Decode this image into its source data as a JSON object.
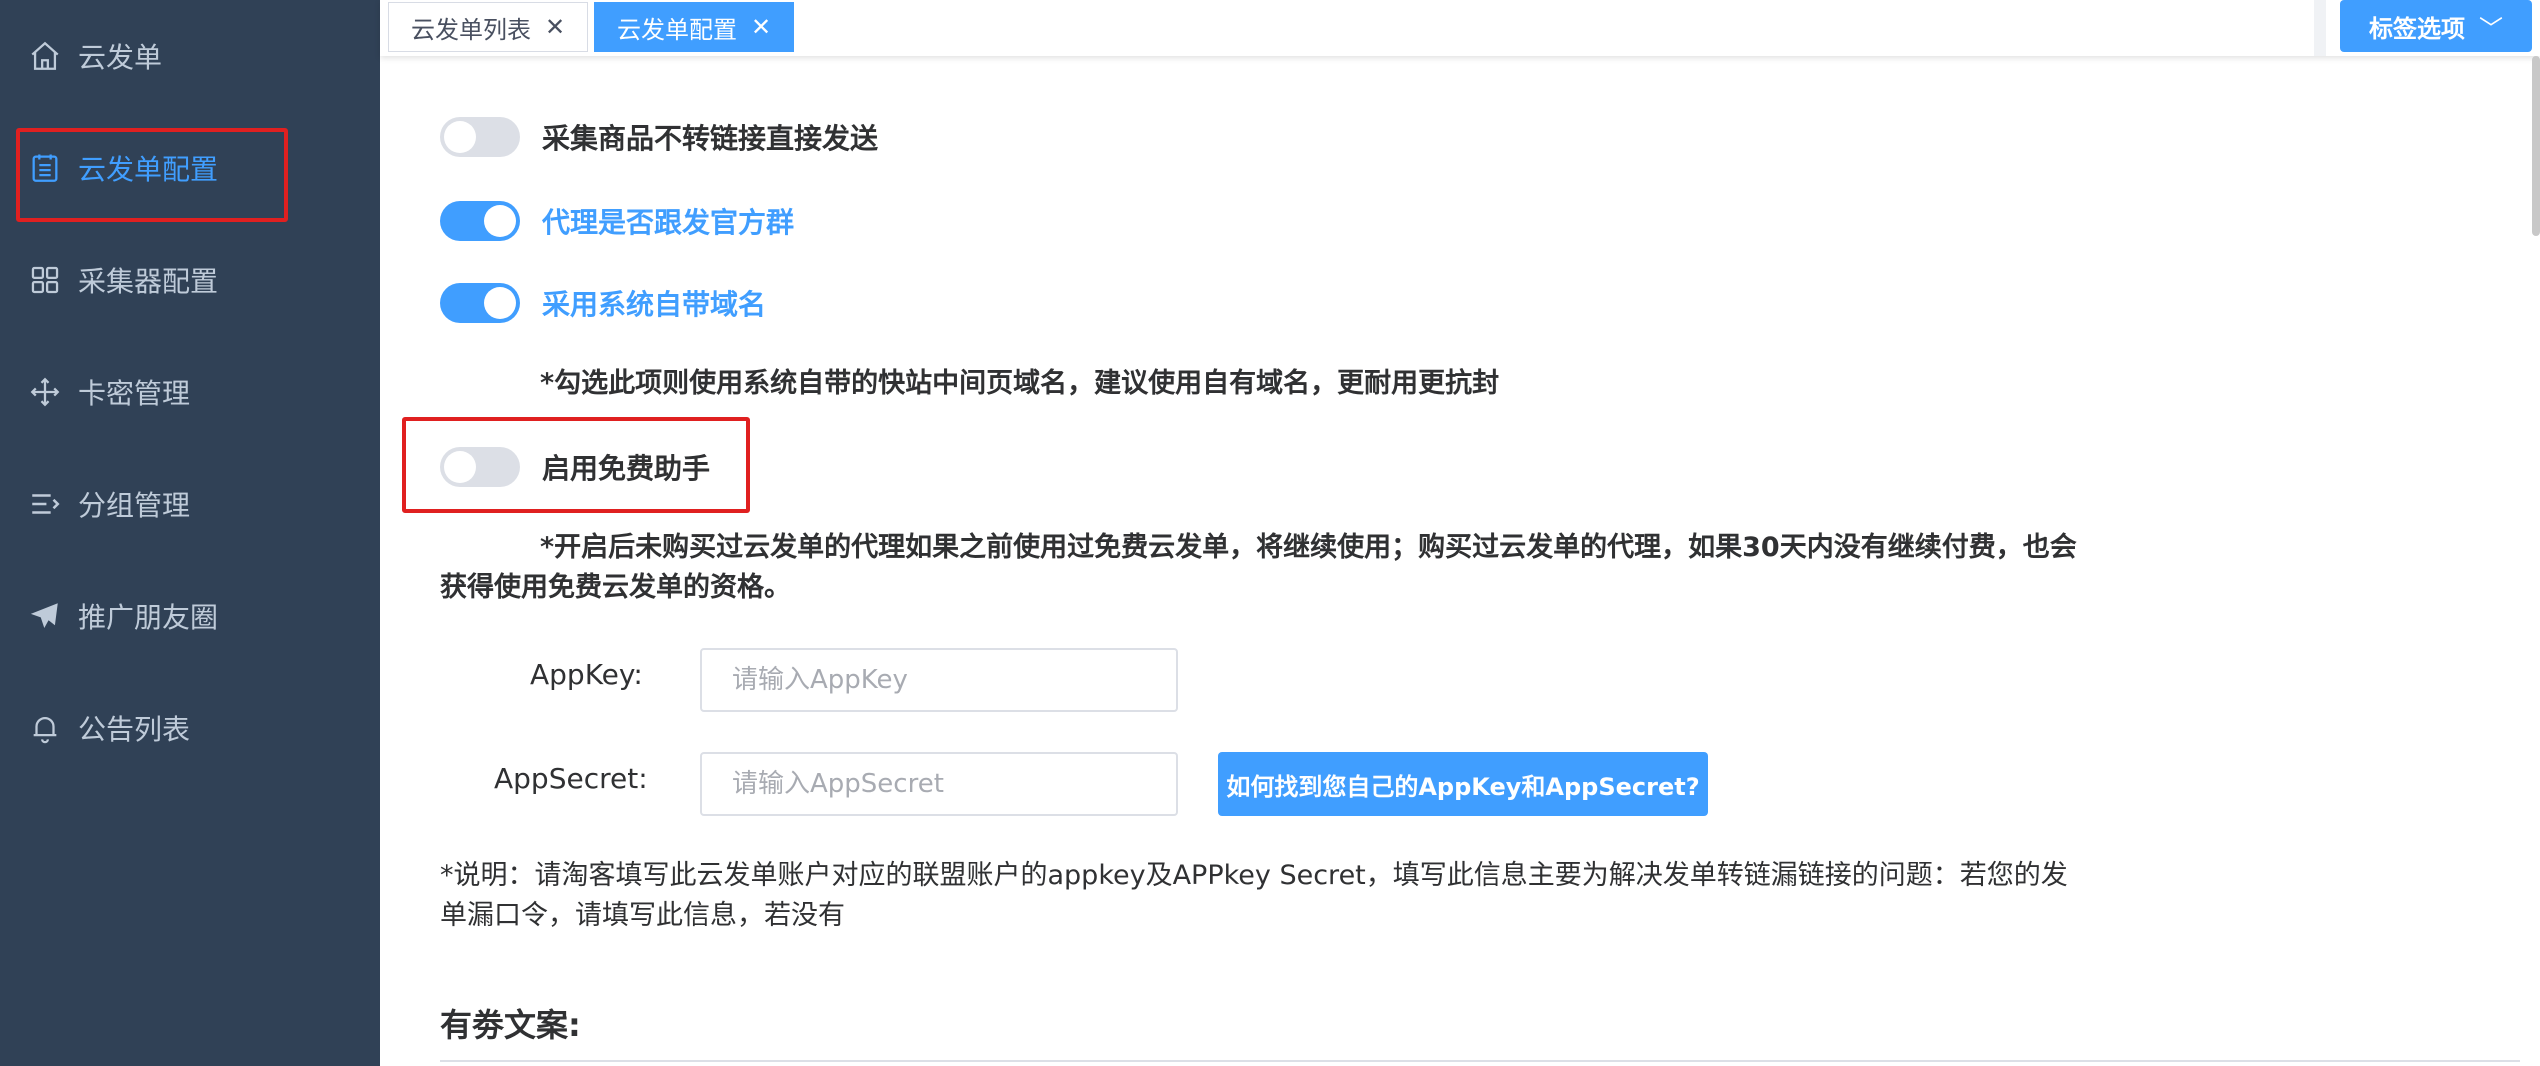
{
  "sidebar": {
    "items": [
      {
        "label": "云发单",
        "icon": "home-icon"
      },
      {
        "label": "云发单配置",
        "icon": "document-list-icon",
        "active": true
      },
      {
        "label": "采集器配置",
        "icon": "grid-icon"
      },
      {
        "label": "卡密管理",
        "icon": "move-icon"
      },
      {
        "label": "分组管理",
        "icon": "sort-icon"
      },
      {
        "label": "推广朋友圈",
        "icon": "paper-plane-icon"
      },
      {
        "label": "公告列表",
        "icon": "bell-icon"
      }
    ]
  },
  "tabs": {
    "items": [
      {
        "label": "云发单列表",
        "close": "✕"
      },
      {
        "label": "云发单配置",
        "close": "✕"
      }
    ],
    "options_label": "标签选项",
    "options_chevron": "﹀"
  },
  "settings": {
    "switch1": {
      "label": "采集商品不转链接直接发送",
      "on": false
    },
    "switch2": {
      "label": "代理是否跟发官方群",
      "on": true
    },
    "switch3": {
      "label": "采用系统自带域名",
      "on": true
    },
    "note_domain": "*勾选此项则使用系统自带的快站中间页域名，建议使用自有域名，更耐用更抗封",
    "switch4": {
      "label": "启用免费助手",
      "on": false
    },
    "note_free_line1": "*开启后未购买过云发单的代理如果之前使用过免费云发单，将继续使用；购买过云发单的代理，如果30天内没有继续付费，也会",
    "note_free_line2": "获得使用免费云发单的资格。"
  },
  "form": {
    "appkey_label": "AppKey:",
    "appkey_placeholder": "请输入AppKey",
    "appsecret_label": "AppSecret:",
    "appsecret_placeholder": "请输入AppSecret",
    "help_button": "如何找到您自己的AppKey和AppSecret?",
    "explain_line1": "*说明：请淘客填写此云发单账户对应的联盟账户的appkey及APPkey Secret，填写此信息主要为解决发单转链漏链接的问题：若您的发",
    "explain_line2": "单漏口令，请填写此信息，若没有"
  },
  "section": {
    "coupon_copy_title": "有劵文案:"
  },
  "colors": {
    "sidebar_bg": "#304156",
    "accent": "#409eff",
    "highlight": "#e02020"
  }
}
